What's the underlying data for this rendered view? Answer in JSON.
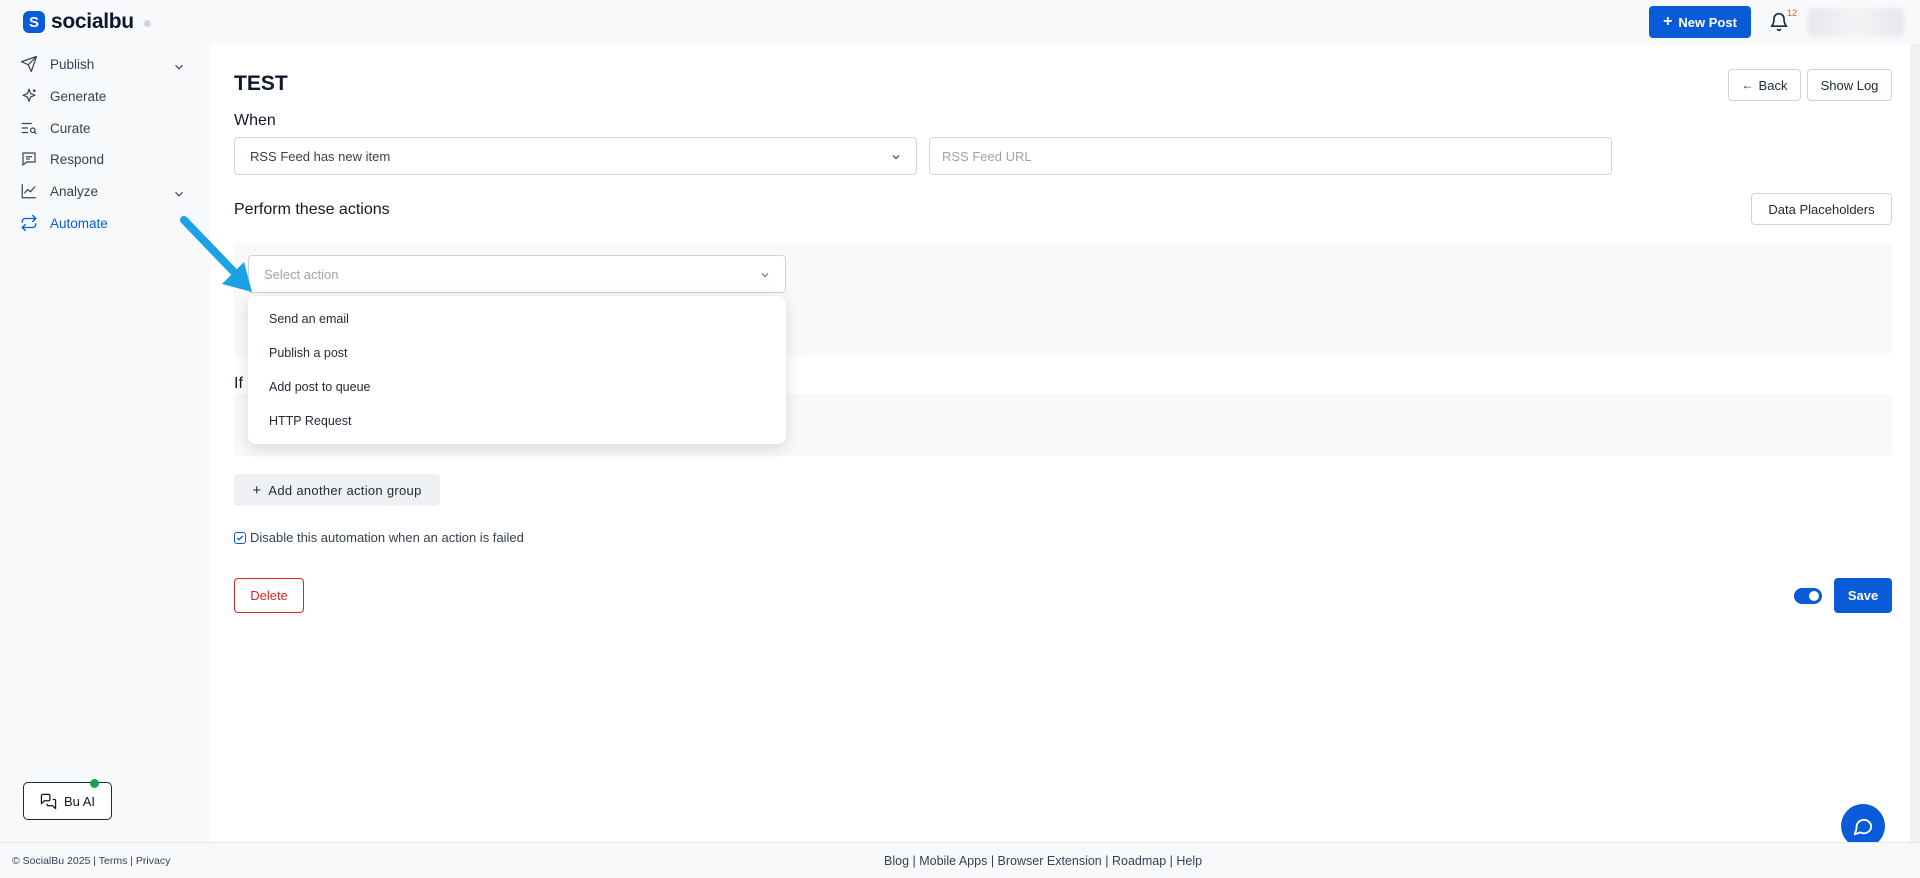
{
  "brand": {
    "name": "socialbu"
  },
  "header": {
    "new_post_label": "New Post",
    "notification_count": "12"
  },
  "sidebar": {
    "items": [
      {
        "label": "Publish",
        "icon": "send-icon",
        "expandable": true
      },
      {
        "label": "Generate",
        "icon": "sparkle-icon",
        "expandable": false
      },
      {
        "label": "Curate",
        "icon": "list-search-icon",
        "expandable": false
      },
      {
        "label": "Respond",
        "icon": "message-icon",
        "expandable": false
      },
      {
        "label": "Analyze",
        "icon": "line-chart-icon",
        "expandable": true
      },
      {
        "label": "Automate",
        "icon": "repeat-icon",
        "expandable": false,
        "active": true
      }
    ],
    "bu_ai_label": "Bu AI"
  },
  "page": {
    "title": "TEST",
    "back_label": "Back",
    "show_log_label": "Show Log",
    "when_label": "When",
    "trigger_value": "RSS Feed has new item",
    "rss_placeholder": "RSS Feed URL",
    "actions_label": "Perform these actions",
    "data_placeholders_label": "Data Placeholders",
    "select_action_placeholder": "Select action",
    "action_options": [
      "Send an email",
      "Publish a post",
      "Add post to queue",
      "HTTP Request"
    ],
    "if_label": "If",
    "add_group_label": "Add another action group",
    "disable_checkbox_label": "Disable this automation when an action is failed",
    "delete_label": "Delete",
    "save_label": "Save"
  },
  "footer": {
    "copyright": "© SocialBu 2025",
    "terms": "Terms",
    "privacy": "Privacy",
    "links": [
      "Blog",
      "Mobile Apps",
      "Browser Extension",
      "Roadmap",
      "Help"
    ]
  },
  "colors": {
    "primary": "#0a5bd8",
    "danger": "#dc2626",
    "arrow": "#1aa1e6"
  }
}
